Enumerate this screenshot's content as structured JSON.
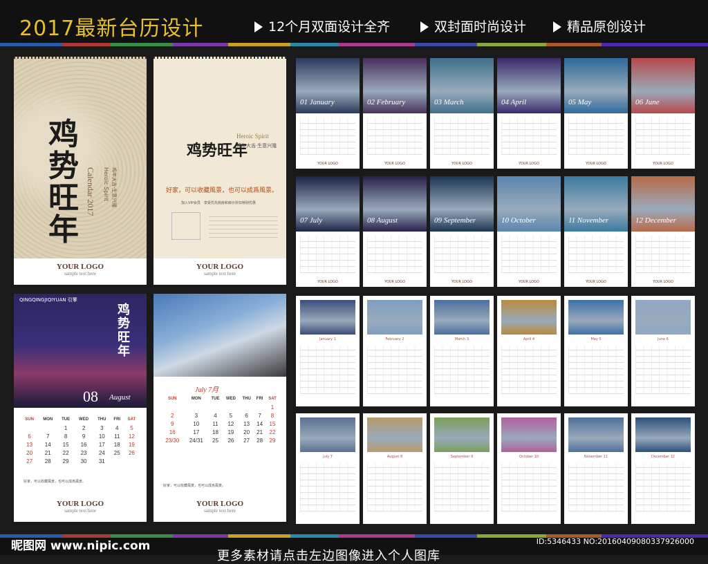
{
  "header": {
    "title": "2017最新台历设计",
    "features": [
      "12个月双面设计全齐",
      "双封面时尚设计",
      "精品原创设计"
    ]
  },
  "covers": {
    "cover1": {
      "calligraphy": "鸡势旺年",
      "brand": "Heroic Spirit",
      "year_text": "Calendar 2017",
      "slogan": "鸡年大吉·生意兴隆",
      "logo": "YOUR LOGO",
      "logo_sub": "sample text here"
    },
    "cover2": {
      "calligraphy": "鸡势旺年",
      "brand": "Heroic Spirit",
      "slogan": "鸡年大吉·生意兴隆",
      "tagline": "好家，可以收藏風景，也可以成爲風景。",
      "vip": "加入VIP会员　享受优先挑房和房价折扣特别优惠",
      "logo": "YOUR LOGO",
      "logo_sub": "sample text here"
    },
    "august_page": {
      "brand_line": "QINGQINGJIQIYUAN 引擎",
      "calligraphy": "鸡势旺年",
      "month_num": "08",
      "month_name": "August",
      "weekdays": [
        "SUN",
        "MON",
        "TUE",
        "WED",
        "THU",
        "FRI",
        "SAT"
      ],
      "weeks": [
        [
          "",
          "",
          "1",
          "2",
          "3",
          "4",
          "5"
        ],
        [
          "6",
          "7",
          "8",
          "9",
          "10",
          "11",
          "12"
        ],
        [
          "13",
          "14",
          "15",
          "16",
          "17",
          "18",
          "19"
        ],
        [
          "20",
          "21",
          "22",
          "23",
          "24",
          "25",
          "26"
        ],
        [
          "27",
          "28",
          "29",
          "30",
          "31",
          "",
          ""
        ]
      ],
      "footnote": "好家，可以收藏風景，也可以成爲風景。",
      "logo": "YOUR LOGO",
      "logo_sub": "sample text here"
    },
    "july_page": {
      "month_label": "July 7月",
      "weekdays": [
        "SUN",
        "MON",
        "TUE",
        "WED",
        "THU",
        "FRI",
        "SAT"
      ],
      "weeks": [
        [
          "",
          "",
          "",
          "",
          "",
          "",
          "1"
        ],
        [
          "2",
          "3",
          "4",
          "5",
          "6",
          "7",
          "8"
        ],
        [
          "9",
          "10",
          "11",
          "12",
          "13",
          "14",
          "15"
        ],
        [
          "16",
          "17",
          "18",
          "19",
          "20",
          "21",
          "22"
        ],
        [
          "23/30",
          "24/31",
          "25",
          "26",
          "27",
          "28",
          "29"
        ]
      ],
      "footnote": "好家，可以收藏風景，也可以成爲風景。",
      "logo": "YOUR LOGO",
      "logo_sub": "sample text here"
    }
  },
  "thumbs_row1": [
    {
      "label": "01 January",
      "color": "#2b3a5c"
    },
    {
      "label": "02 February",
      "color": "#4a2f5c"
    },
    {
      "label": "03 March",
      "color": "#3f6f8c"
    },
    {
      "label": "04 April",
      "color": "#3b2a6b"
    },
    {
      "label": "05 May",
      "color": "#2d6a9a"
    },
    {
      "label": "06 June",
      "color": "#b7494a"
    }
  ],
  "thumbs_row2": [
    {
      "label": "07 July",
      "color": "#1d2347"
    },
    {
      "label": "08 August",
      "color": "#28204a"
    },
    {
      "label": "09 September",
      "color": "#1c3553"
    },
    {
      "label": "10 October",
      "color": "#5a86b0"
    },
    {
      "label": "11 November",
      "color": "#3a7aa0"
    },
    {
      "label": "12 December",
      "color": "#b96a4a"
    }
  ],
  "thumbs_row3": [
    {
      "label": "January 1",
      "color": "#3a4d7a"
    },
    {
      "label": "February 2",
      "color": "#7f9ec2"
    },
    {
      "label": "March 3",
      "color": "#4a6fa0"
    },
    {
      "label": "April 4",
      "color": "#b98a3a"
    },
    {
      "label": "May 5",
      "color": "#3d6fa8"
    },
    {
      "label": "June 6",
      "color": "#8fa8c4"
    }
  ],
  "thumbs_row4": [
    {
      "label": "July 7",
      "color": "#5a6f94"
    },
    {
      "label": "August 8",
      "color": "#b99a6a"
    },
    {
      "label": "September 9",
      "color": "#7aa05a"
    },
    {
      "label": "October 10",
      "color": "#b05fa0"
    },
    {
      "label": "November 11",
      "color": "#4f6f9a"
    },
    {
      "label": "December 12",
      "color": "#2a4f7a"
    }
  ],
  "thumb_logo": "YOUR LOGO",
  "footer": {
    "watermark": "昵图网 www.nipic.com",
    "id_text": "ID:5346433 NO:20160409080337926000",
    "more": "更多素材请点击左边图像进入个人图库"
  }
}
